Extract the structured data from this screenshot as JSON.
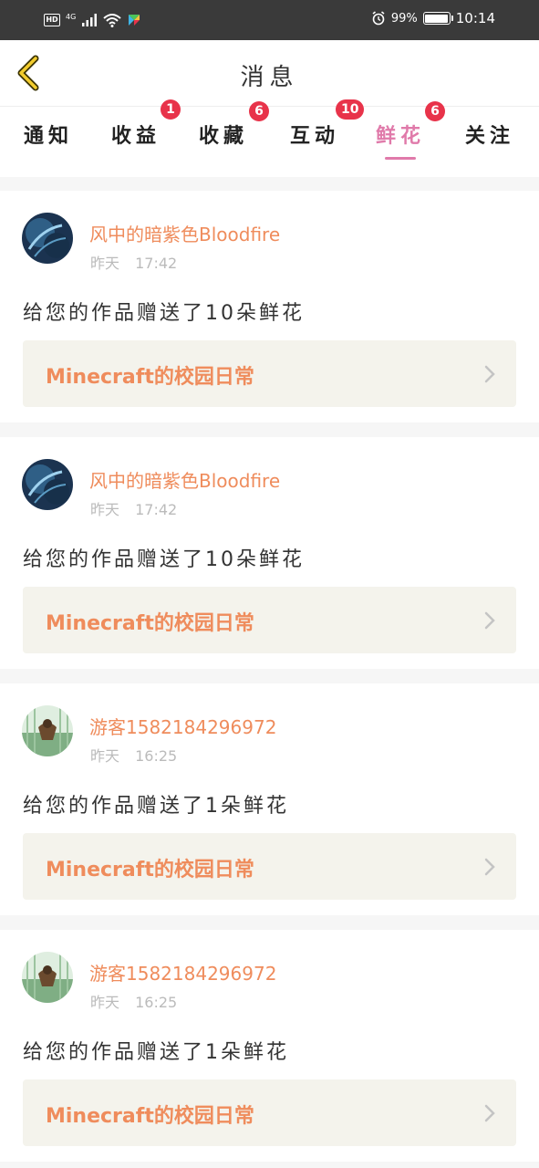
{
  "status_bar": {
    "left_badge": "HD",
    "network": "4G",
    "battery": "99%",
    "battery_level": 0.99,
    "time": "10:14"
  },
  "header": {
    "title": "消息",
    "back_icon": "chevron-left-icon"
  },
  "tabs": [
    {
      "label": "通知",
      "badge": ""
    },
    {
      "label": "收益",
      "badge": "1"
    },
    {
      "label": "收藏",
      "badge": "6"
    },
    {
      "label": "互动",
      "badge": "10"
    },
    {
      "label": "鲜花",
      "badge": "6",
      "active": true
    },
    {
      "label": "关注",
      "badge": ""
    }
  ],
  "colors": {
    "accent": "#e07aaa",
    "username": "#ef8c5c",
    "badge": "#e8334a"
  },
  "notifications": [
    {
      "user": "风中的暗紫色Bloodfire",
      "date": "昨天",
      "time": "17:42",
      "message": "给您的作品赠送了10朵鲜花",
      "work": "Minecraft的校园日常"
    },
    {
      "user": "风中的暗紫色Bloodfire",
      "date": "昨天",
      "time": "17:42",
      "message": "给您的作品赠送了10朵鲜花",
      "work": "Minecraft的校园日常"
    },
    {
      "user": "游客1582184296972",
      "date": "昨天",
      "time": "16:25",
      "message": "给您的作品赠送了1朵鲜花",
      "work": "Minecraft的校园日常"
    },
    {
      "user": "游客1582184296972",
      "date": "昨天",
      "time": "16:25",
      "message": "给您的作品赠送了1朵鲜花",
      "work": "Minecraft的校园日常"
    }
  ]
}
